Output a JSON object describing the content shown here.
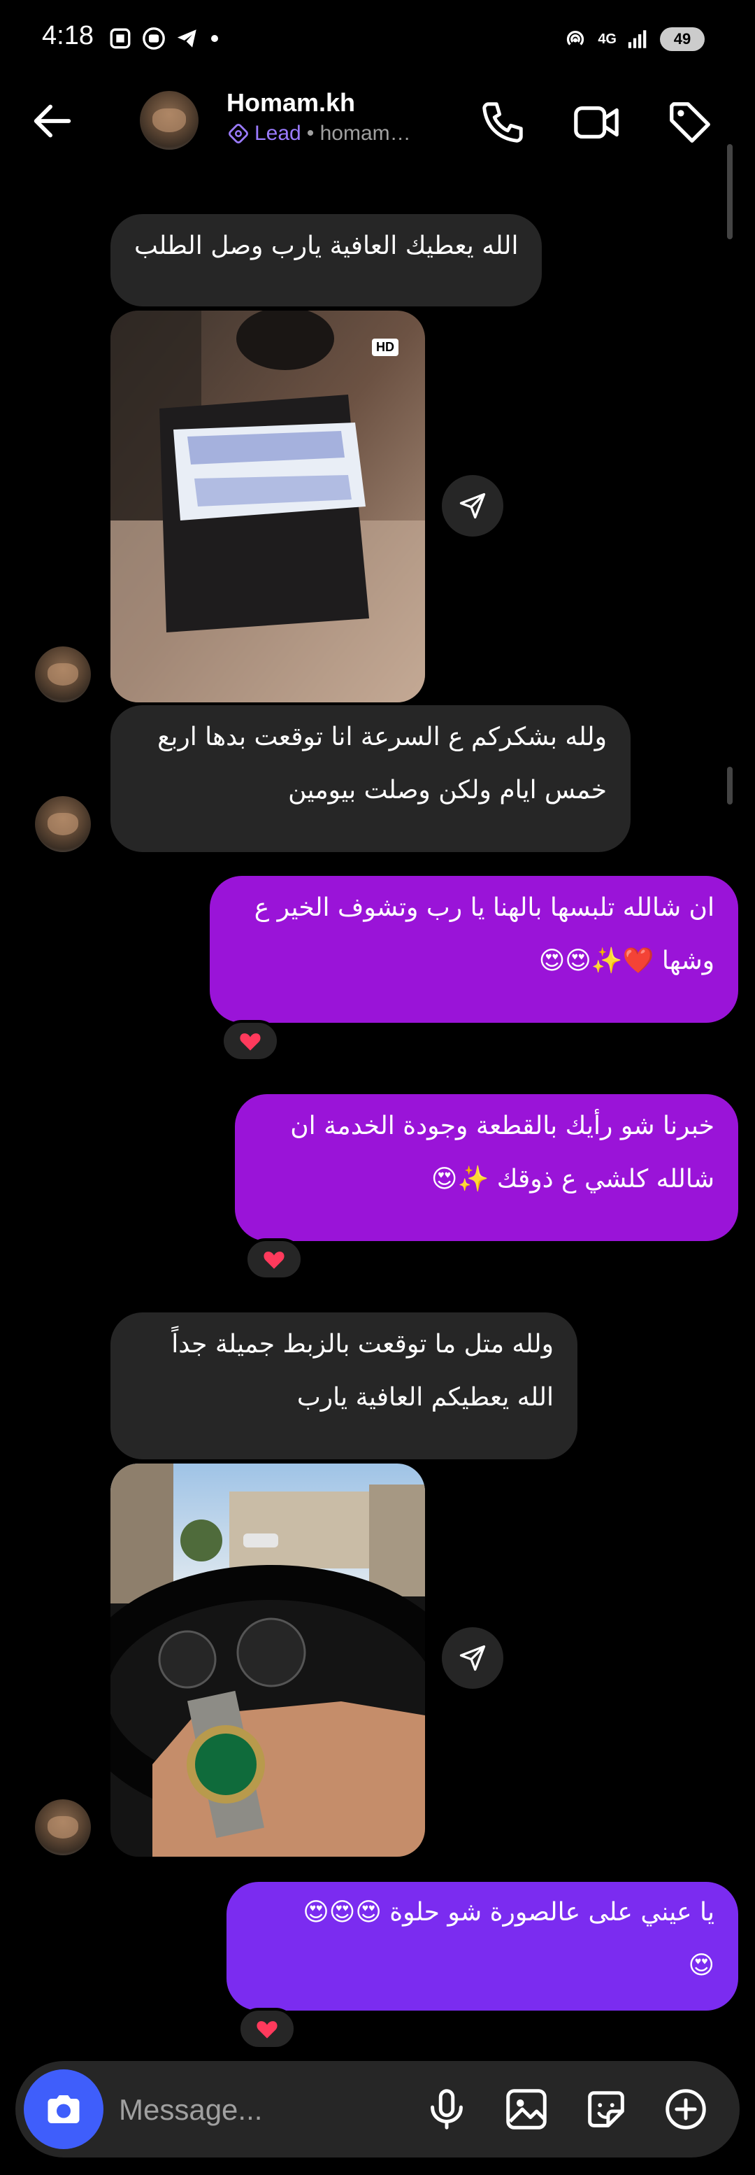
{
  "status": {
    "time": "4:18",
    "battery": "49",
    "network": "4G"
  },
  "header": {
    "name": "Homam.kh",
    "badge": "Lead",
    "handle": "homam…"
  },
  "messages": {
    "m1": "الله يعطيك العافية يارب وصل الطلب",
    "m2_l1": "ولله بشكركم ع السرعة انا توقعت بدها اربع",
    "m2_l2": "خمس ايام ولكن وصلت بيومين",
    "m3_l1": "ان شالله تلبسها بالهنا يا رب وتشوف الخير ع",
    "m3_l2": "وشها ❤️✨😍😍",
    "m4_l1": "خبرنا شو رأيك بالقطعة وجودة الخدمة ان",
    "m4_l2": "شالله كلشي ع ذوقك ✨😍",
    "m5_l1": "ولله متل ما توقعت بالزبط جميلة جداً",
    "m5_l2": "الله يعطيكم العافية يارب",
    "m6_l1": "يا عيني على عالصورة شو حلوة 😍😍😍",
    "m6_l2": "😍"
  },
  "photo_badge": "HD",
  "composer": {
    "placeholder": "Message..."
  },
  "colors": {
    "incoming": "#262626",
    "outgoing_purple": "#9a14d8",
    "outgoing_violet": "#7b2cf0",
    "camera": "#3f5efb",
    "lead": "#9b7bff"
  }
}
